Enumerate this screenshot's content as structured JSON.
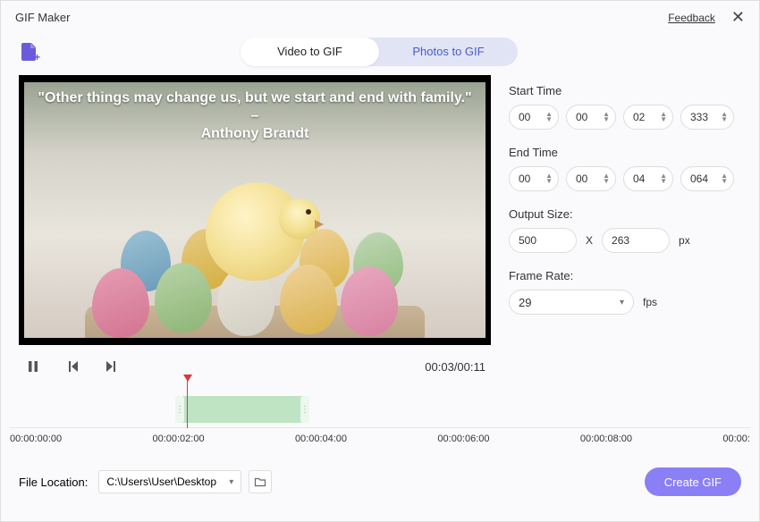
{
  "titlebar": {
    "title": "GIF Maker",
    "feedback": "Feedback"
  },
  "tabs": {
    "video": "Video to GIF",
    "photos": "Photos to GIF"
  },
  "quote": {
    "line1": "\"Other things may change us, but we start and end with family.\" –",
    "line2": "Anthony Brandt"
  },
  "playback": {
    "time": "00:03/00:11"
  },
  "settings": {
    "start_label": "Start Time",
    "start": {
      "h": "00",
      "m": "00",
      "s": "02",
      "ms": "333"
    },
    "end_label": "End Time",
    "end": {
      "h": "00",
      "m": "00",
      "s": "04",
      "ms": "064"
    },
    "size_label": "Output Size:",
    "size": {
      "w": "500",
      "x": "X",
      "h": "263",
      "unit": "px"
    },
    "fps_label": "Frame Rate:",
    "fps": {
      "value": "29",
      "unit": "fps"
    }
  },
  "timeline": {
    "ticks": [
      "00:00:00:00",
      "00:00:02:00",
      "00:00:04:00",
      "00:00:06:00",
      "00:00:08:00",
      "00:00:"
    ]
  },
  "footer": {
    "label": "File Location:",
    "path": "C:\\Users\\User\\Desktop",
    "create": "Create GIF"
  }
}
